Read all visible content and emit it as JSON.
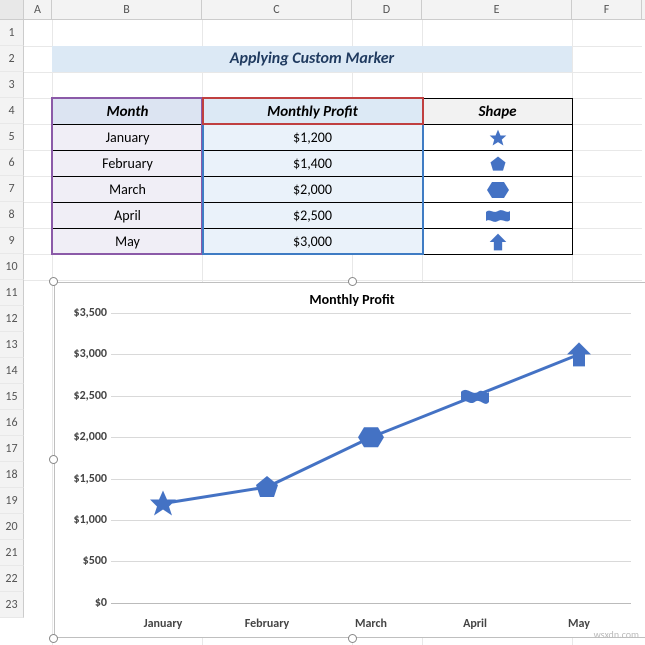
{
  "columns": [
    "A",
    "B",
    "C",
    "D",
    "E",
    "F"
  ],
  "rows_visible": 23,
  "title_banner": "Applying Custom Marker",
  "table": {
    "headers": {
      "month": "Month",
      "profit": "Monthly Profit",
      "shape": "Shape"
    },
    "rows": [
      {
        "month": "January",
        "profit": "$1,200",
        "shape": "star"
      },
      {
        "month": "February",
        "profit": "$1,400",
        "shape": "pentagon"
      },
      {
        "month": "March",
        "profit": "$2,000",
        "shape": "hexagon"
      },
      {
        "month": "April",
        "profit": "$2,500",
        "shape": "wave"
      },
      {
        "month": "May",
        "profit": "$3,000",
        "shape": "arrow-up"
      }
    ]
  },
  "chart_data": {
    "type": "line",
    "title": "Monthly Profit",
    "categories": [
      "January",
      "February",
      "March",
      "April",
      "May"
    ],
    "values": [
      1200,
      1400,
      2000,
      2500,
      3000
    ],
    "markers": [
      "star",
      "pentagon",
      "hexagon",
      "wave",
      "arrow-up"
    ],
    "xlabel": "",
    "ylabel": "",
    "ylim": [
      0,
      3500
    ],
    "ytick_labels": [
      "$0",
      "$500",
      "$1,000",
      "$1,500",
      "$2,000",
      "$2,500",
      "$3,000",
      "$3,500"
    ],
    "yticks": [
      0,
      500,
      1000,
      1500,
      2000,
      2500,
      3000,
      3500
    ],
    "line_color": "#4472c4"
  },
  "selection": {
    "month_range": "B4:B9",
    "profit_range": "C4:C9",
    "profit_header_range": "C4:D4"
  },
  "watermark": "wsxdn.com"
}
